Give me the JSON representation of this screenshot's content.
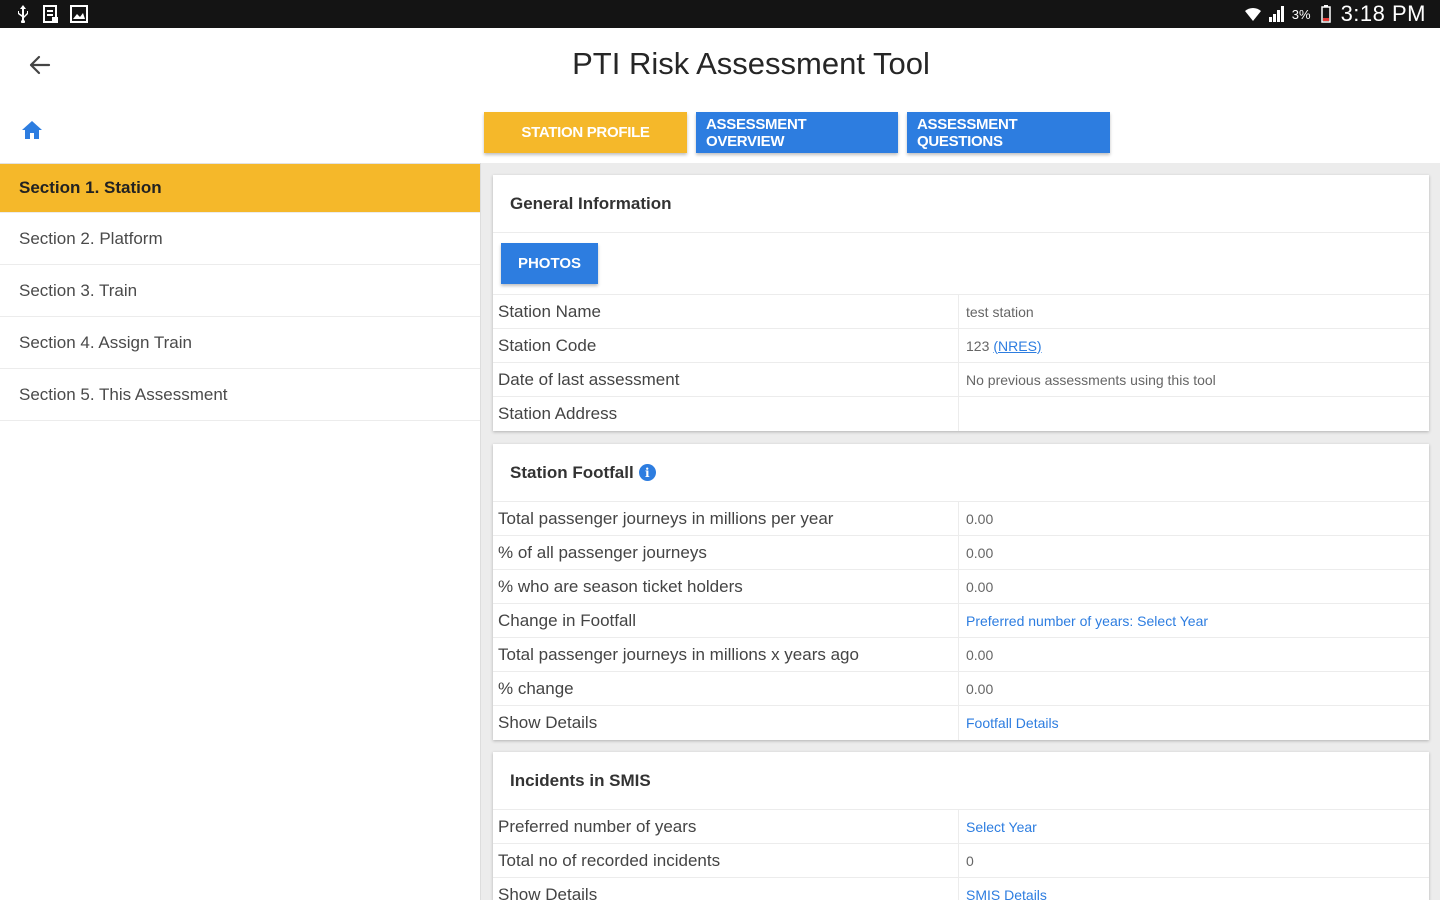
{
  "status_bar": {
    "left_icons": [
      "usb-icon",
      "file-icon",
      "image-icon"
    ],
    "right_icons": [
      "wifi-icon",
      "signal-icon",
      "battery-icon"
    ],
    "battery": "3%",
    "time": "3:18 PM"
  },
  "app_bar": {
    "back_icon": "arrow-left-icon",
    "title": "PTI Risk Assessment Tool"
  },
  "home_icon": "home-icon",
  "tabs": [
    {
      "label": "STATION PROFILE",
      "active": true
    },
    {
      "label": "ASSESSMENT OVERVIEW",
      "active": false
    },
    {
      "label": "ASSESSMENT QUESTIONS",
      "active": false
    }
  ],
  "sidebar": {
    "items": [
      {
        "label": "Section 1. Station",
        "active": true
      },
      {
        "label": "Section 2. Platform",
        "active": false
      },
      {
        "label": "Section 3. Train",
        "active": false
      },
      {
        "label": "Section 4. Assign Train",
        "active": false
      },
      {
        "label": "Section 5. This Assessment",
        "active": false
      }
    ]
  },
  "general": {
    "title": "General Information",
    "photos_label": "PHOTOS",
    "rows": [
      {
        "label": "Station Name",
        "value": "test station"
      },
      {
        "label": "Station Code",
        "value": "123",
        "link": "(NRES)"
      },
      {
        "label": "Date of last assessment",
        "value": "No previous assessments using this tool"
      },
      {
        "label": "Station Address",
        "value": ""
      }
    ]
  },
  "footfall": {
    "title": "Station Footfall",
    "info_icon": "info-icon",
    "info_glyph": "i",
    "rows": [
      {
        "label": "Total passenger journeys in millions per year",
        "value": "0.00"
      },
      {
        "label": "% of all passenger journeys",
        "value": "0.00"
      },
      {
        "label": "% who are season ticket holders",
        "value": "0.00"
      },
      {
        "label": "Change in Footfall",
        "link": "Preferred number of years: Select Year"
      },
      {
        "label": "Total passenger journeys in millions x years ago",
        "value": "0.00"
      },
      {
        "label": "% change",
        "value": "0.00"
      },
      {
        "label": "Show Details",
        "link": "Footfall Details"
      }
    ]
  },
  "smis": {
    "title": "Incidents in SMIS",
    "rows": [
      {
        "label": "Preferred number of years",
        "link": "Select Year"
      },
      {
        "label": "Total no of recorded incidents",
        "value": "0"
      },
      {
        "label": "Show Details",
        "link": "SMIS Details"
      }
    ]
  },
  "colors": {
    "accent_yellow": "#f5b82a",
    "accent_blue": "#2d7de0",
    "status_bar": "#141414"
  }
}
